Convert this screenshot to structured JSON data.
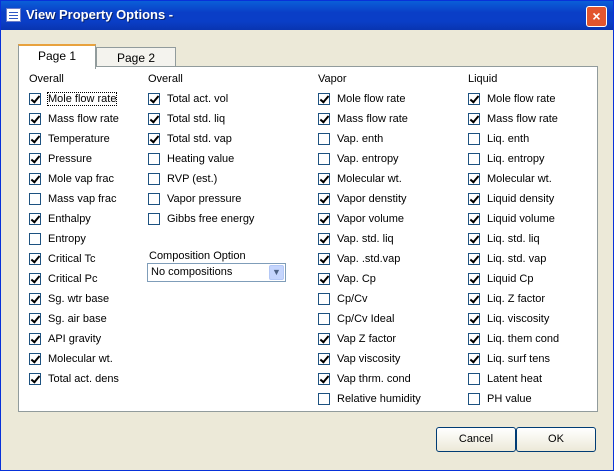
{
  "window": {
    "title": "View Property Options  -",
    "close_label": "×"
  },
  "tabs": [
    {
      "label": "Page 1",
      "active": true
    },
    {
      "label": "Page 2",
      "active": false
    }
  ],
  "columns": [
    {
      "header": "Overall",
      "items": [
        {
          "label": "Mole flow rate",
          "checked": true
        },
        {
          "label": "Mass flow rate",
          "checked": true
        },
        {
          "label": "Temperature",
          "checked": true
        },
        {
          "label": "Pressure",
          "checked": true
        },
        {
          "label": "Mole vap frac",
          "checked": true
        },
        {
          "label": "Mass vap frac",
          "checked": false
        },
        {
          "label": "Enthalpy",
          "checked": true
        },
        {
          "label": "Entropy",
          "checked": false
        },
        {
          "label": "Critical Tc",
          "checked": true
        },
        {
          "label": "Critical Pc",
          "checked": true
        },
        {
          "label": "Sg. wtr base",
          "checked": true
        },
        {
          "label": "Sg. air base",
          "checked": true
        },
        {
          "label": "API gravity",
          "checked": true
        },
        {
          "label": "Molecular wt.",
          "checked": true
        },
        {
          "label": "Total act. dens",
          "checked": true
        }
      ]
    },
    {
      "header": "Overall",
      "items": [
        {
          "label": "Total act. vol",
          "checked": true
        },
        {
          "label": "Total std. liq",
          "checked": true
        },
        {
          "label": "Total std. vap",
          "checked": true
        },
        {
          "label": "Heating value",
          "checked": false
        },
        {
          "label": "RVP (est.)",
          "checked": false
        },
        {
          "label": "Vapor pressure",
          "checked": false
        },
        {
          "label": "Gibbs free energy",
          "checked": false
        }
      ]
    },
    {
      "header": "Vapor",
      "items": [
        {
          "label": "Mole flow rate",
          "checked": true
        },
        {
          "label": "Mass flow rate",
          "checked": true
        },
        {
          "label": "Vap. enth",
          "checked": false
        },
        {
          "label": "Vap. entropy",
          "checked": false
        },
        {
          "label": "Molecular wt.",
          "checked": true
        },
        {
          "label": "Vapor denstity",
          "checked": true
        },
        {
          "label": "Vapor volume",
          "checked": true
        },
        {
          "label": "Vap. std. liq",
          "checked": true
        },
        {
          "label": "Vap. .std.vap",
          "checked": true
        },
        {
          "label": "Vap. Cp",
          "checked": true
        },
        {
          "label": "Cp/Cv",
          "checked": false
        },
        {
          "label": "Cp/Cv Ideal",
          "checked": false
        },
        {
          "label": "Vap Z factor",
          "checked": true
        },
        {
          "label": "Vap viscosity",
          "checked": true
        },
        {
          "label": "Vap thrm. cond",
          "checked": true
        },
        {
          "label": "Relative humidity",
          "checked": false
        }
      ]
    },
    {
      "header": "Liquid",
      "items": [
        {
          "label": "Mole flow rate",
          "checked": true
        },
        {
          "label": "Mass flow rate",
          "checked": true
        },
        {
          "label": "Liq. enth",
          "checked": false
        },
        {
          "label": "Liq. entropy",
          "checked": false
        },
        {
          "label": "Molecular wt.",
          "checked": true
        },
        {
          "label": "Liquid density",
          "checked": true
        },
        {
          "label": "Liquid volume",
          "checked": true
        },
        {
          "label": "Liq. std. liq",
          "checked": true
        },
        {
          "label": "Liq. std. vap",
          "checked": true
        },
        {
          "label": "Liquid Cp",
          "checked": true
        },
        {
          "label": "Liq. Z factor",
          "checked": true
        },
        {
          "label": "Liq. viscosity",
          "checked": true
        },
        {
          "label": "Liq. them cond",
          "checked": true
        },
        {
          "label": "Liq. surf tens",
          "checked": true
        },
        {
          "label": "Latent heat",
          "checked": false
        },
        {
          "label": "PH value",
          "checked": false
        }
      ]
    }
  ],
  "composition": {
    "label": "Composition Option",
    "value": "No compositions",
    "dropdown_icon": "chevron-down-icon"
  },
  "buttons": {
    "cancel": "Cancel",
    "ok": "OK"
  }
}
